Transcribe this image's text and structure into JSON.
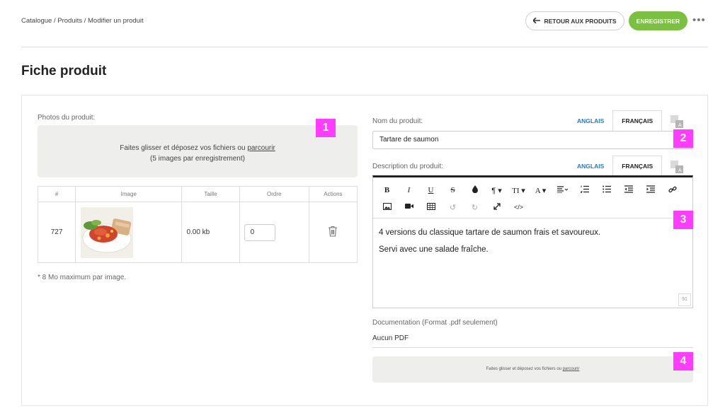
{
  "breadcrumb": "Catalogue / Produits / Modifier un produit",
  "header": {
    "back_label": "RETOUR AUX PRODUITS",
    "save_label": "ENREGISTRER",
    "more_label": "•••"
  },
  "page": {
    "title": "Fiche produit"
  },
  "photos": {
    "label": "Photos du produit:",
    "dropzone_text": "Faites glisser et déposez vos fichiers ou",
    "dropzone_link": "parcourir",
    "dropzone_sub": "(5 images par enregistrement)",
    "columns": [
      "#",
      "Image",
      "Taille",
      "Ordre",
      "Actions"
    ],
    "rows": [
      {
        "id": "727",
        "size": "0.00 kb",
        "order": "0"
      }
    ],
    "note": "* 8 Mo maximum par image."
  },
  "name_field": {
    "label": "Nom du produit:",
    "tab_en": "ANGLAIS",
    "tab_fr": "FRANÇAIS",
    "value": "Tartare de saumon"
  },
  "description": {
    "label": "Description du produit:",
    "tab_en": "ANGLAIS",
    "tab_fr": "FRANÇAIS",
    "line1": "4 versions du classique tartare de saumon frais et savoureux.",
    "line2": "Servi avec une salade fraîche.",
    "char_count": "91"
  },
  "documentation": {
    "label": "Documentation (Format .pdf seulement)",
    "value": "Aucun PDF",
    "dropzone_text": "Faites glisser et déposez vos fichiers ou",
    "dropzone_link": "parcourir"
  },
  "markers": [
    "1",
    "2",
    "3",
    "4"
  ],
  "colors": {
    "save": "#7ac141",
    "marker": "#ff3cff",
    "lang_link": "#2a7bbd",
    "dropzone_bg": "#eeeeed"
  }
}
